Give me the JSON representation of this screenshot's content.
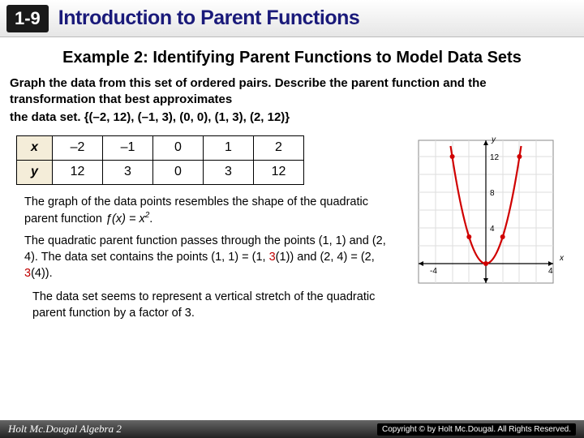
{
  "header": {
    "badge": "1-9",
    "title": "Introduction to Parent Functions"
  },
  "example_title": "Example 2: Identifying Parent Functions to Model Data Sets",
  "instruction": "Graph the data from this set of ordered pairs. Describe the parent function and the transformation that best approximates",
  "set_lead": "the data set.",
  "set_points": "{(–2, 12), (–1, 3), (0, 0), (1, 3), (2, 12)}",
  "table": {
    "x_label": "x",
    "y_label": "y",
    "x": [
      "–2",
      "–1",
      "0",
      "1",
      "2"
    ],
    "y": [
      "12",
      "3",
      "0",
      "3",
      "12"
    ]
  },
  "para1_a": "The graph of the data points resembles the shape of the quadratic parent function ",
  "para1_fx": "ƒ(x) = x",
  "para1_exp": "2",
  "para1_end": ".",
  "para2_a": "The quadratic parent function passes through the points (1, 1) and (2, 4). The data set contains the points (1, 1) = (1, ",
  "para2_r1": "3",
  "para2_b": "(1)) and (2, 4) = (2, ",
  "para2_r2": "3",
  "para2_c": "(4)).",
  "conclusion": "The data set seems to represent a vertical stretch of the quadratic parent function by a factor of 3.",
  "footer": {
    "left": "Holt Mc.Dougal Algebra 2",
    "right": "Copyright © by Holt Mc.Dougal. All Rights Reserved."
  },
  "chart_data": {
    "type": "scatter",
    "title": "",
    "xlabel": "x",
    "ylabel": "y",
    "xlim": [
      -4,
      4
    ],
    "ylim": [
      -2,
      14
    ],
    "xticks": [
      -4,
      4
    ],
    "yticks": [
      4,
      8,
      12
    ],
    "series": [
      {
        "name": "curve",
        "type": "line",
        "color": "#d00000",
        "x": [
          -2.1,
          -2,
          -1.5,
          -1,
          -0.5,
          0,
          0.5,
          1,
          1.5,
          2,
          2.1
        ],
        "y": [
          13.2,
          12,
          6.75,
          3,
          0.75,
          0,
          0.75,
          3,
          6.75,
          12,
          13.2
        ]
      },
      {
        "name": "points",
        "type": "scatter",
        "color": "#d00000",
        "x": [
          -2,
          -1,
          0,
          1,
          2
        ],
        "y": [
          12,
          3,
          0,
          3,
          12
        ]
      }
    ]
  }
}
